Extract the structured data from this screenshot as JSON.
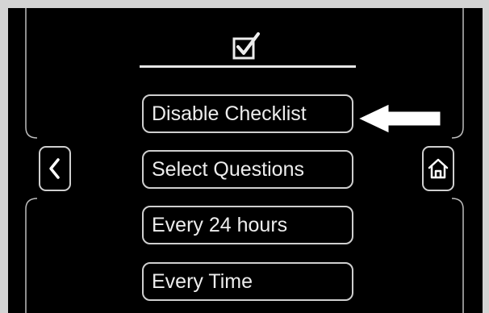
{
  "header": {
    "icon": "checkbox-checked-icon"
  },
  "menu": {
    "items": [
      {
        "label": "Disable Checklist"
      },
      {
        "label": "Select Questions"
      },
      {
        "label": "Every 24 hours"
      },
      {
        "label": "Every Time"
      }
    ]
  },
  "nav": {
    "back_icon": "chevron-left-icon",
    "home_icon": "home-icon"
  },
  "annotation": {
    "icon": "arrow-left-icon",
    "target": "Disable Checklist"
  },
  "colors": {
    "screen_background": "#000000",
    "border": "#cfcfcf",
    "text": "#ededed",
    "outer_background": "#d4d4d4"
  }
}
